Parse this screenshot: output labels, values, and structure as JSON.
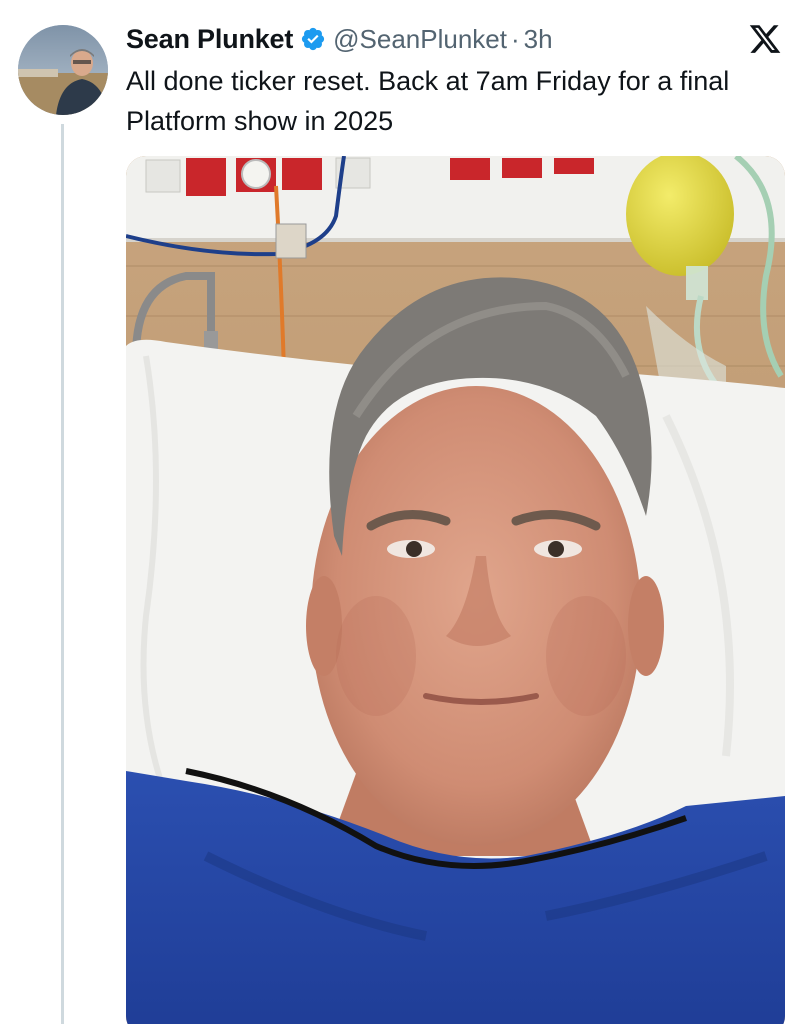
{
  "tweet": {
    "author": {
      "display_name": "Sean Plunket",
      "handle": "@SeanPlunket",
      "verified": true,
      "avatar_icon": "profile-photo"
    },
    "separator": "·",
    "time": "3h",
    "text": "All done ticker reset. Back at 7am Friday for a final Platform show in 2025",
    "media": {
      "kind": "photo",
      "description_icon": "selfie-photo"
    }
  },
  "colors": {
    "text_primary": "#0f1419",
    "text_secondary": "#536471",
    "verified_blue": "#1d9bf0",
    "thread_line": "#cfd9de"
  },
  "icons": {
    "verified": "verified-badge-icon",
    "platform": "x-logo-icon"
  }
}
